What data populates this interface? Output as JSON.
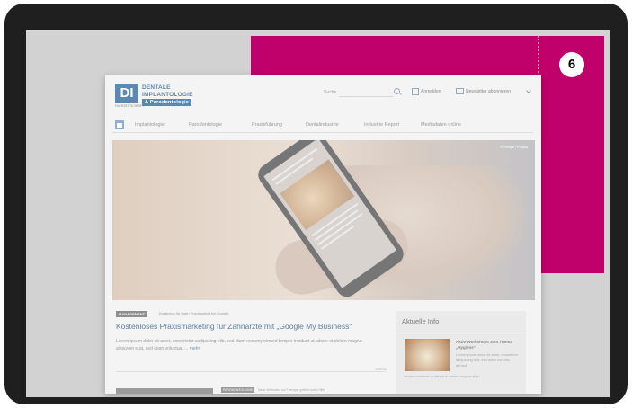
{
  "step_number": "6",
  "colors": {
    "frame": "#1f1f1f",
    "screen_background": "#d2d2d2",
    "ad_banner": "#c0006b",
    "brand_blue": "#5a88b0"
  },
  "site": {
    "logo": {
      "mark": "DI",
      "line1": "DENTALE",
      "line2": "IMPLANTOLOGIE",
      "line3": "& Parodontologie",
      "sub": "FACHZEITSCHRIFT"
    },
    "header": {
      "search_label": "Suche",
      "login_label": "Anmelden",
      "newsletter_label": "Newsletter abonnieren"
    },
    "nav": {
      "items": [
        "Implantologie",
        "Parodontologie",
        "Praxisführung",
        "Dentalindustrie",
        "Industrie Report",
        "Mediadaten online"
      ]
    },
    "hero": {
      "credit": "© Gettys / Fotolia"
    },
    "article": {
      "category": "MANAGEMENT",
      "subtitle": "Kostenlos für Ihren Praxisauftritt bei Google",
      "title": "Kostenloses Praxismarketing für Zahnärzte mit „Google My Business\"",
      "teaser": "Lorem ipsum dolor sit amet, consetetur sadipscing elitr, sed diam nonumy eirmod tempor invidunt ut labore et dolore magna aliquyam erat, sed diam voluptua. ...",
      "more": "mehr",
      "divider_label": "ANZEIGE"
    },
    "bottom": {
      "badge": "PARODONTOLOGIE",
      "text": "Neue Methoden zur Therapie geführt unter Hilfe"
    },
    "sidebar": {
      "title": "Aktuelle Info",
      "item_title": "Aktiv-Workshops zum Thema „Hygiene\"",
      "item_text": "Lorem ipsum dolor sit amet, consetetur sadipscing elitr, sed diam nonumy eirmod",
      "item_tail": "tempor invidunt ut labore et dolore magna aliqu"
    }
  }
}
